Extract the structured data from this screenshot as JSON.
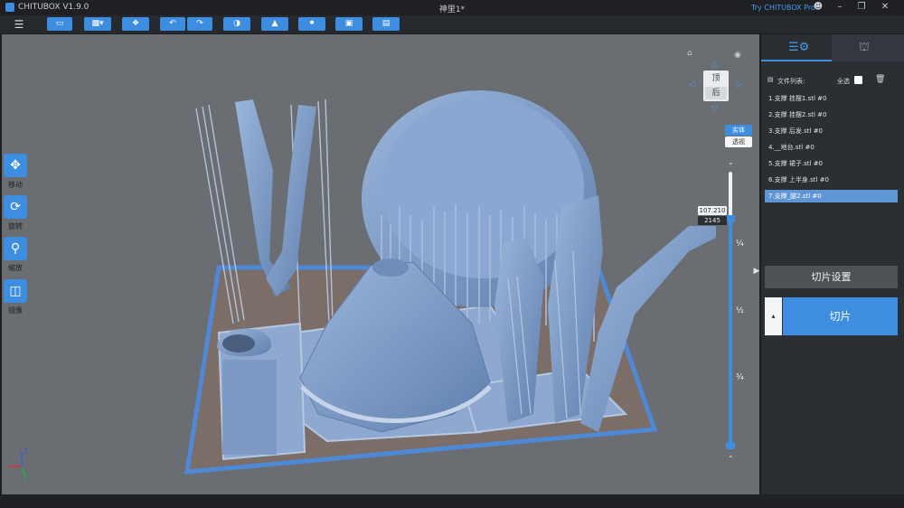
{
  "titlebar": {
    "app_name": "CHITUBOX V1.9.0",
    "document": "神里1*",
    "pro_link": "Try CHITUBOX Pro"
  },
  "toolbar": {
    "menu_icon": "menu-icon",
    "tools": [
      "open-icon",
      "save-icon",
      "auto-layout-icon",
      "undo-icon",
      "redo-icon",
      "slice-preview-icon",
      "support-icon",
      "hollow-icon",
      "settings-icon",
      "tool-lock-icon"
    ]
  },
  "left_tools": {
    "move": "移动",
    "rotate": "旋转",
    "scale": "缩放",
    "mirror": "镜像"
  },
  "view_cube": {
    "top_face": "顶",
    "front_face": "后"
  },
  "render_mode": {
    "solid": "实体",
    "xray": "透视"
  },
  "slider": {
    "height": "107.210",
    "layer": "2145",
    "one_quarter": "¼",
    "half": "½",
    "three_quarter": "¾",
    "level_fraction": 0.83
  },
  "panel": {
    "file_list_label": "文件列表:",
    "select_all": "全选",
    "files": [
      "1.支撑 挂摆1.stl #0",
      "2.支撑 挂摆2.stl #0",
      "3.支撑 后发.stl #0",
      "4.__地台.stl #0",
      "5.支撑 裙子.stl #0",
      "6.支撑 上半身.stl #0",
      "7.支撑_腿2.stl #0"
    ],
    "selected_index": 6,
    "slice_settings": "切片设置",
    "slice": "切片"
  },
  "colors": {
    "accent": "#3d8ee0",
    "model": "#7c9cc7",
    "viewport": "#6a6d72",
    "plate": "#4f89d6"
  }
}
